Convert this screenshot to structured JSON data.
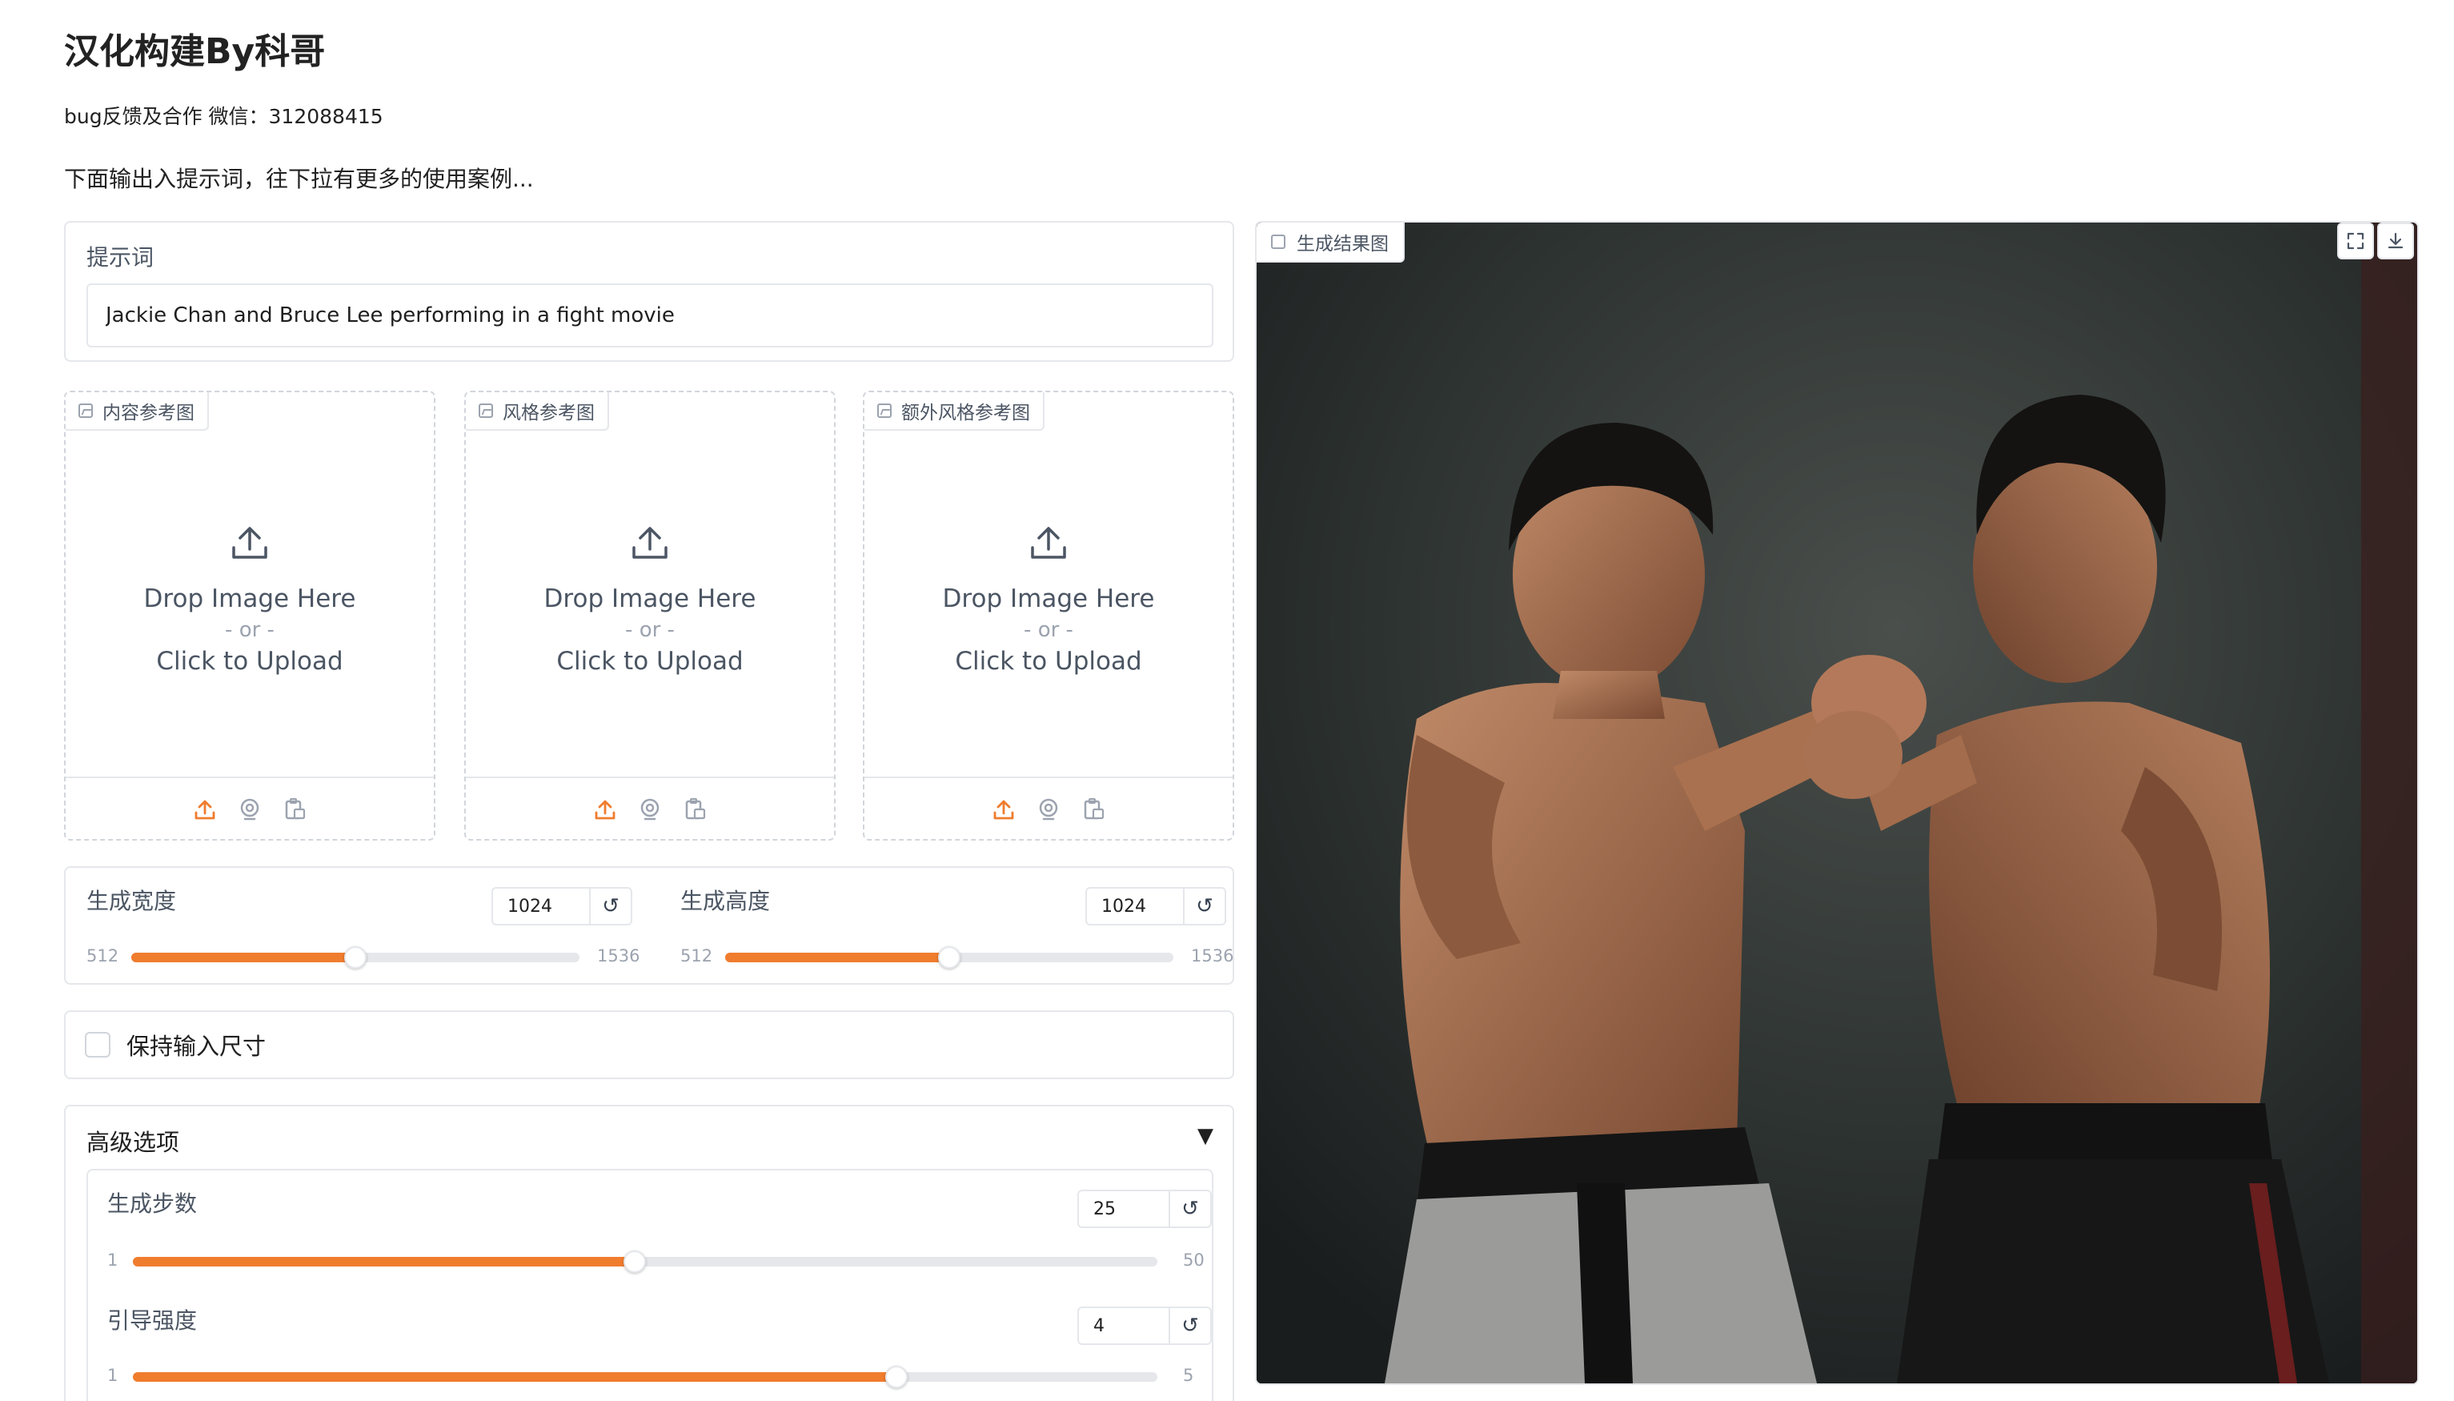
{
  "header": {
    "title": "汉化构建By科哥",
    "contact": "bug反馈及合作 微信：312088415",
    "hint": "下面输出入提示词，往下拉有更多的使用案例..."
  },
  "prompt": {
    "label": "提示词",
    "value": "Jackie Chan and Bruce Lee performing in a fight movie"
  },
  "uploads": [
    {
      "label": "内容参考图",
      "drop": "Drop Image Here",
      "or": "- or -",
      "click": "Click to Upload"
    },
    {
      "label": "风格参考图",
      "drop": "Drop Image Here",
      "or": "- or -",
      "click": "Click to Upload"
    },
    {
      "label": "额外风格参考图",
      "drop": "Drop Image Here",
      "or": "- or -",
      "click": "Click to Upload"
    }
  ],
  "size": {
    "width": {
      "label": "生成宽度",
      "value": "1024",
      "min": "512",
      "max": "1536",
      "fraction": 0.5
    },
    "height": {
      "label": "生成高度",
      "value": "1024",
      "min": "512",
      "max": "1536",
      "fraction": 0.5
    }
  },
  "keep_size": {
    "label": "保持输入尺寸",
    "checked": false
  },
  "advanced": {
    "title": "高级选项",
    "caret": "▼",
    "steps": {
      "label": "生成步数",
      "value": "25",
      "min": "1",
      "max": "50",
      "fraction": 0.49
    },
    "guidance": {
      "label": "引导强度",
      "value": "4",
      "min": "1",
      "max": "5",
      "fraction": 0.745
    }
  },
  "output": {
    "label": "生成结果图"
  },
  "colors": {
    "accent": "#f07c2e",
    "border": "#e5e7eb",
    "muted": "#9ca3af"
  },
  "icons": {
    "reset": "↺"
  }
}
